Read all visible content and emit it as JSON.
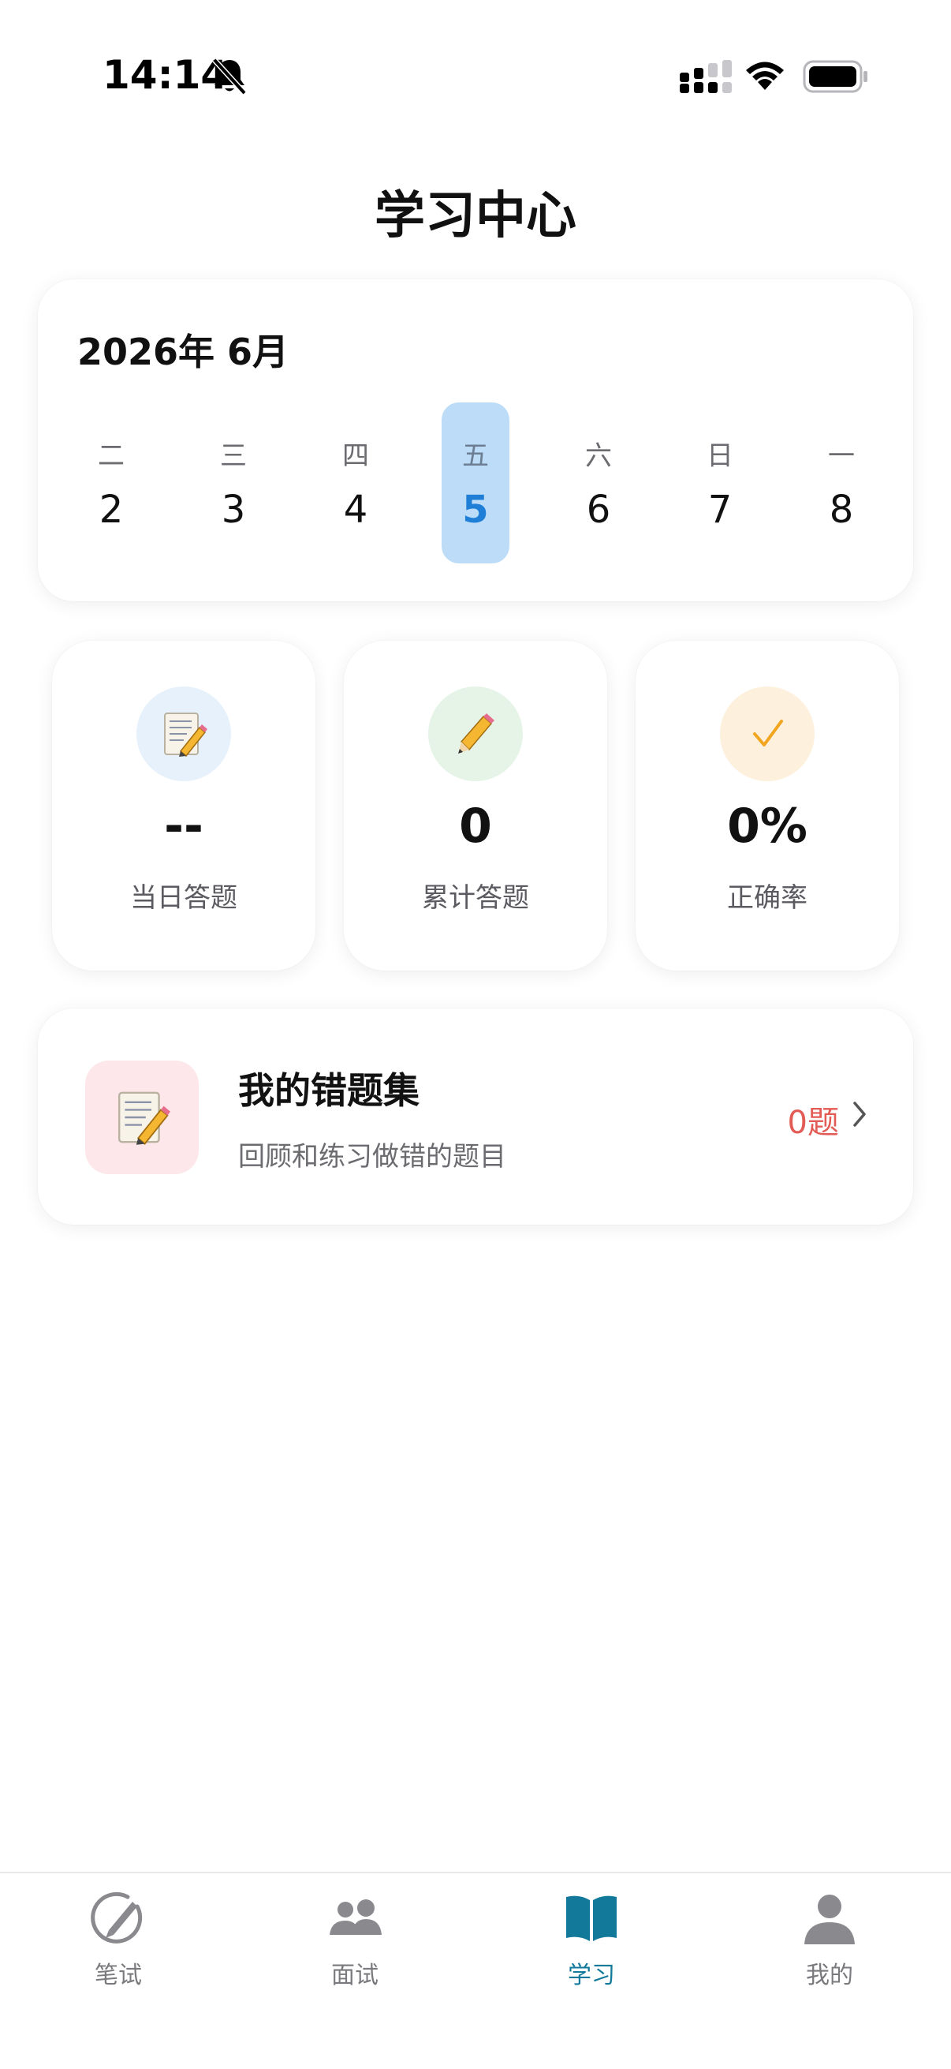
{
  "status_bar": {
    "time": "14:14"
  },
  "page": {
    "title": "学习中心"
  },
  "calendar": {
    "month": "2026年 6月",
    "days": [
      {
        "weekday": "二",
        "date": "2"
      },
      {
        "weekday": "三",
        "date": "3"
      },
      {
        "weekday": "四",
        "date": "4"
      },
      {
        "weekday": "五",
        "date": "5"
      },
      {
        "weekday": "六",
        "date": "6"
      },
      {
        "weekday": "日",
        "date": "7"
      },
      {
        "weekday": "一",
        "date": "8"
      }
    ],
    "selected_date": "5"
  },
  "stats": [
    {
      "value": "--",
      "label": "当日答题",
      "icon": "memo-icon",
      "bg": "#e6f1fc"
    },
    {
      "value": "0",
      "label": "累计答题",
      "icon": "pencil-icon",
      "bg": "#e6f4e8"
    },
    {
      "value": "0%",
      "label": "正确率",
      "icon": "checkmark-icon",
      "bg": "#fdf0dc"
    }
  ],
  "wrong_questions": {
    "title": "我的错题集",
    "subtitle": "回顾和练习做错的题目",
    "count": "0题"
  },
  "tabs": [
    {
      "label": "笔试",
      "icon": "pen-circle-icon",
      "active": false
    },
    {
      "label": "面试",
      "icon": "people-icon",
      "active": false
    },
    {
      "label": "学习",
      "icon": "book-icon",
      "active": true
    },
    {
      "label": "我的",
      "icon": "person-icon",
      "active": false
    }
  ],
  "colors": {
    "accent": "#13799b",
    "selected_day_bg": "#bcdcf8",
    "selected_day_text": "#1f7fd6",
    "wrong_count": "#e25b55",
    "inactive_tab": "#7a7a7e"
  }
}
